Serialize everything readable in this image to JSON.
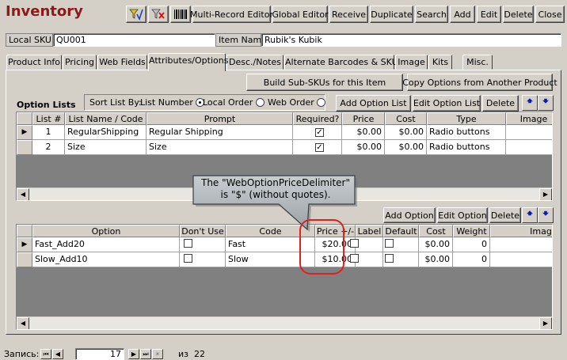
{
  "app": {
    "title": "Inventory"
  },
  "toolbar": {
    "buttons": [
      "Multi-Record Editor",
      "Global Editor",
      "Receive",
      "Duplicate",
      "Search",
      "Add",
      "Edit",
      "Delete",
      "Close"
    ]
  },
  "record": {
    "local_sku_label": "Local SKU",
    "local_sku": "QU001",
    "item_name_label": "Item Name",
    "item_name": "Rubik's Kubik"
  },
  "tabs": [
    "Product Info",
    "Pricing",
    "Web Fields",
    "Attributes/Options",
    "Desc./Notes",
    "Alternate Barcodes & SKUs",
    "Image",
    "Kits",
    "Misc."
  ],
  "attributes": {
    "build_sub_skus": "Build Sub-SKUs for this Item",
    "copy_options": "Copy Options from Another Product",
    "option_lists_title": "Option Lists",
    "sort_label": "Sort List By:",
    "sort_options": [
      "List Number",
      "Local Order",
      "Web Order"
    ],
    "sort_selected": "List Number",
    "add_option_list": "Add Option List",
    "edit_option_list": "Edit Option List",
    "delete": "Delete",
    "lists_columns": [
      "List #",
      "List Name / Code",
      "Prompt",
      "Required?",
      "Price",
      "Cost",
      "Type",
      "Image"
    ],
    "lists_rows": [
      {
        "num": "1",
        "name": "RegularShipping",
        "prompt": "Regular Shipping",
        "required": true,
        "price": "$0.00",
        "cost": "$0.00",
        "type": "Radio buttons"
      },
      {
        "num": "2",
        "name": "Size",
        "prompt": "Size",
        "required": true,
        "price": "$0.00",
        "cost": "$0.00",
        "type": "Radio buttons"
      }
    ],
    "add_option": "Add Option",
    "edit_option": "Edit Option",
    "option_delete": "Delete",
    "options_columns": [
      "Option",
      "Don't Use",
      "Code",
      "Price +/-",
      "Label",
      "Default",
      "Cost",
      "Weight",
      "Imag"
    ],
    "options_rows": [
      {
        "option": "Fast_Add20",
        "dont_use": false,
        "code": "Fast",
        "price": "$20.00",
        "label": false,
        "default": false,
        "cost": "$0.00",
        "weight": "0"
      },
      {
        "option": "Slow_Add10",
        "dont_use": false,
        "code": "Slow",
        "price": "$10.00",
        "label": false,
        "default": false,
        "cost": "$0.00",
        "weight": "0"
      }
    ]
  },
  "callout": {
    "line1": "The \"WebOptionPriceDelimiter\"",
    "line2": "is \"$\" (without quotes)."
  },
  "record_nav": {
    "label": "Запись:",
    "current": "17",
    "of_label": "из",
    "total": "22"
  },
  "colors": {
    "title": "#8b1a1a",
    "callout_fill": "#aeb4b8",
    "highlight_circle": "#e02020",
    "arrow_blue": "#0018c8"
  }
}
